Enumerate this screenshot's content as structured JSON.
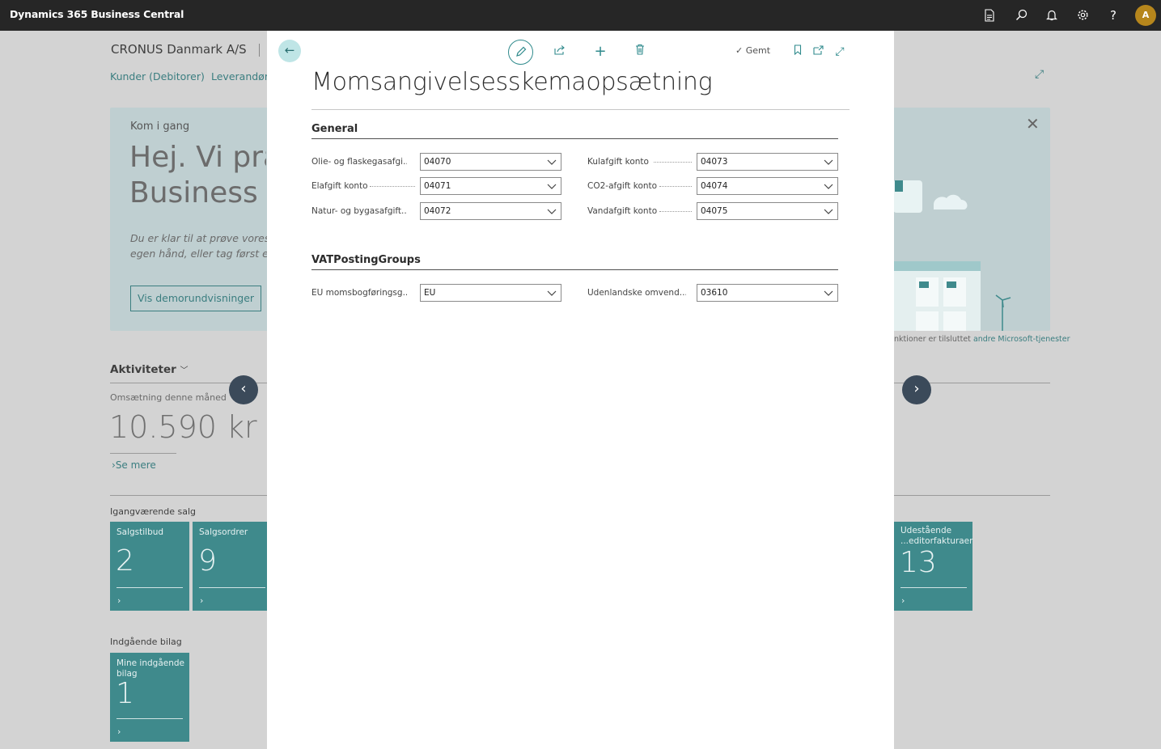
{
  "app": {
    "title": "Dynamics 365 Business Central",
    "avatar_initial": "A",
    "accent": "#2f8a8c"
  },
  "topbar_icons": [
    "document-icon",
    "search-icon",
    "bell-icon",
    "gear-icon",
    "help-icon"
  ],
  "background": {
    "company": "CRONUS Danmark A/S",
    "nav": [
      "Kunder (Debitorer)",
      "Leverandøre"
    ],
    "hero": {
      "label": "Kom i gang",
      "heading_line1": "Hej. Vi præ",
      "heading_line2": "Business C",
      "intro_line1": "Du er klar til at prøve vores",
      "intro_line2": "egen hånd, eller tag først en",
      "demo_button": "Vis demorundvisninger",
      "connected_text": "nktioner er tilsluttet",
      "connected_link": "andre Microsoft-tjenester"
    },
    "activities": {
      "title": "Aktiviteter",
      "omsaetning_label": "Omsætning denne måned",
      "omsaetning_value": "10.590 kr",
      "se_mere": "Se mere"
    },
    "igangvaerende_label": "Igangværende salg",
    "indgaaende_label": "Indgående bilag",
    "tiles": [
      {
        "name": "Salgstilbud",
        "value": "2"
      },
      {
        "name": "Salgsordrer",
        "value": "9"
      },
      {
        "name": "Udestående ...editorfakturaer",
        "value": "13"
      },
      {
        "name": "Mine indgående bilag",
        "value": "1"
      }
    ]
  },
  "modal": {
    "saved_label": "Gemt",
    "title": "Momsangivelsesskemaopsætning",
    "groups": [
      {
        "title": "General",
        "fields": [
          {
            "label": "Olie- og flaskegasafgi...",
            "value": "04070"
          },
          {
            "label": "Kulafgift konto",
            "value": "04073"
          },
          {
            "label": "Elafgift konto",
            "value": "04071"
          },
          {
            "label": "CO2-afgift konto",
            "value": "04074"
          },
          {
            "label": "Natur- og bygasafgift...",
            "value": "04072"
          },
          {
            "label": "Vandafgift konto",
            "value": "04075"
          }
        ]
      },
      {
        "title": "VATPostingGroups",
        "fields": [
          {
            "label": "EU momsbogføringsg...",
            "value": "EU"
          },
          {
            "label": "Udenlandske omvend...",
            "value": "03610"
          }
        ]
      }
    ]
  }
}
